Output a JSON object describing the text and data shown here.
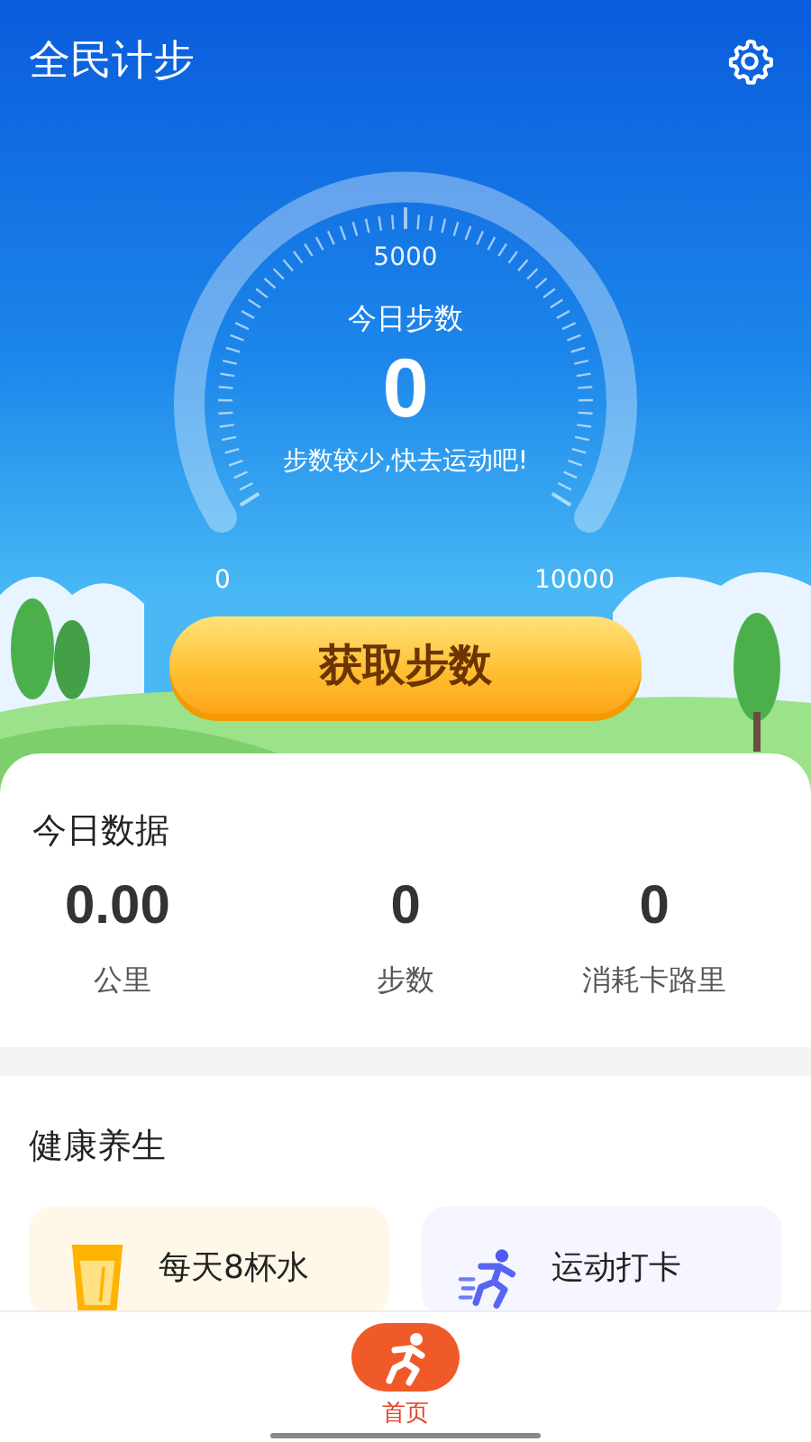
{
  "app_bar": {
    "title": "全民计步"
  },
  "gauge": {
    "label": "今日步数",
    "value": "0",
    "hint": "步数较少,快去运动吧!",
    "scale_min": "0",
    "scale_mid": "5000",
    "scale_max": "10000"
  },
  "action_button": "获取步数",
  "today": {
    "title": "今日数据",
    "stats": [
      {
        "value": "0.00",
        "label": "公里"
      },
      {
        "value": "0",
        "label": "步数"
      },
      {
        "value": "0",
        "label": "消耗卡路里"
      }
    ]
  },
  "health": {
    "title": "健康养生",
    "cards": [
      {
        "kind": "water",
        "title": "每天8杯水"
      },
      {
        "kind": "exercise",
        "title": "运动打卡"
      }
    ]
  },
  "bottom_nav": [
    {
      "label": "首页",
      "selected": true
    }
  ]
}
